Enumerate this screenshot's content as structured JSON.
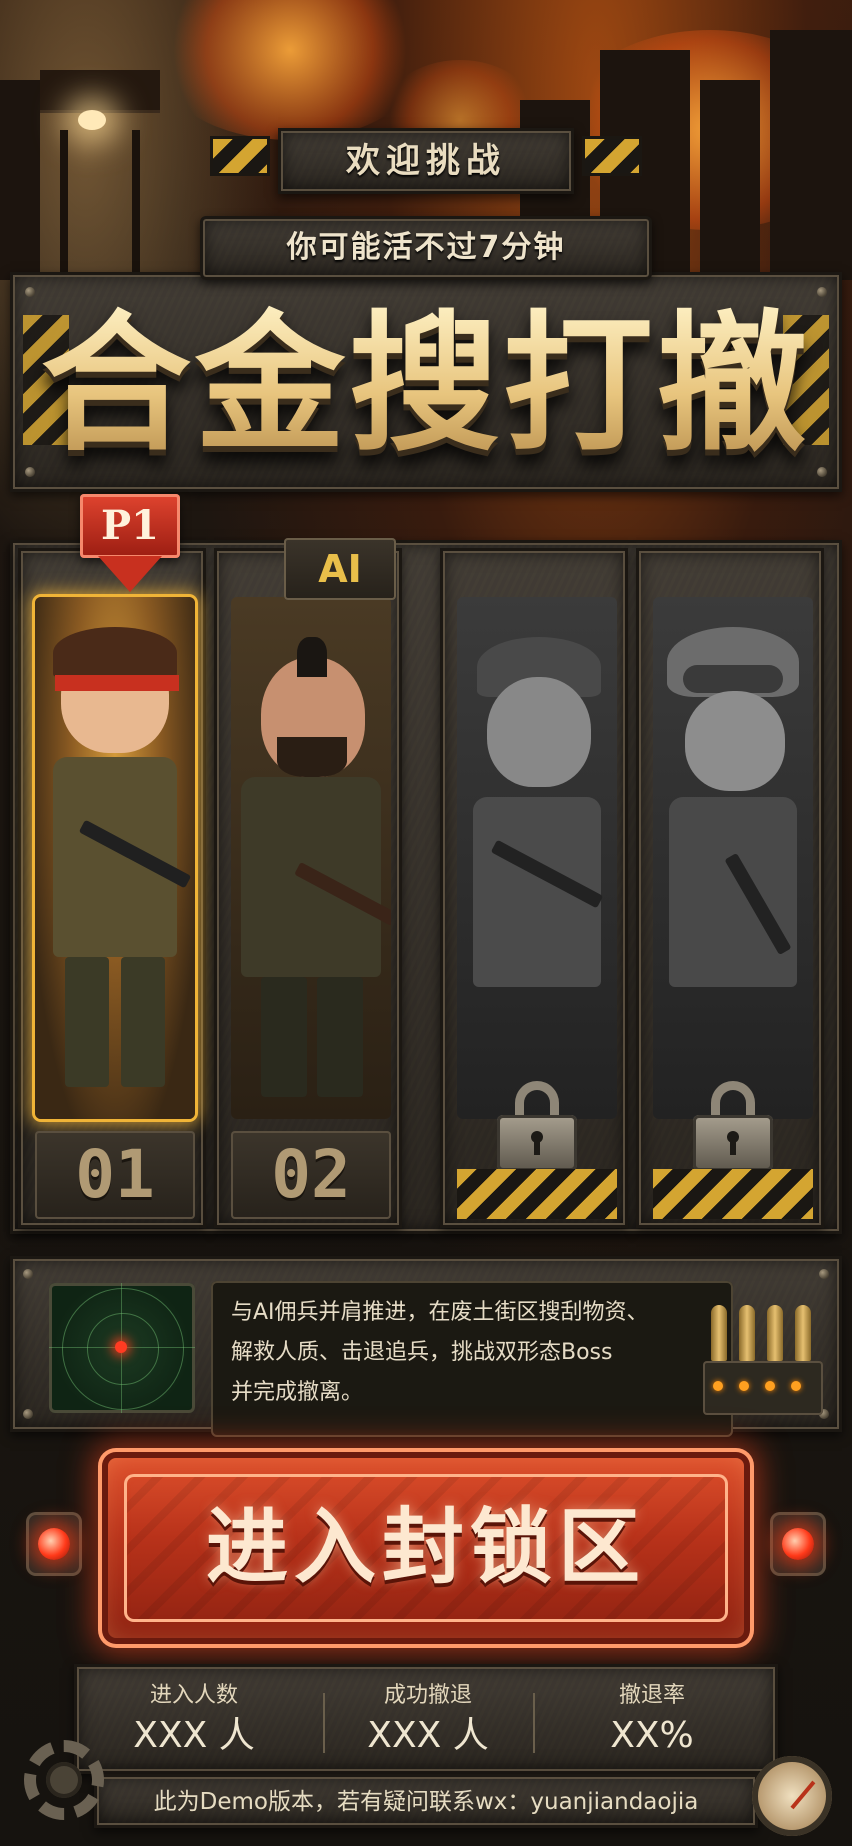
{
  "header": {
    "welcome": "欢迎挑战",
    "subtitle": "你可能活不过7分钟",
    "title": "合金搜打撤"
  },
  "roster": {
    "p1_tag": "P1",
    "ai_tag": "AI",
    "slots": [
      {
        "number": "01",
        "state": "selected",
        "character": "red-headband-soldier"
      },
      {
        "number": "02",
        "state": "ai",
        "character": "mohawk-heavy-gunner"
      },
      {
        "number": "",
        "state": "locked",
        "character": "skull-cap-sniper"
      },
      {
        "number": "",
        "state": "locked",
        "character": "goggles-scout"
      }
    ]
  },
  "briefing": {
    "lines": [
      "与AI佣兵并肩推进，在废土街区搜刮物资、",
      "解救人质、击退追兵，挑战双形态Boss",
      "并完成撤离。"
    ]
  },
  "start_button": {
    "label": "进入封锁区"
  },
  "stats": [
    {
      "label": "进入人数",
      "value": "XXX 人"
    },
    {
      "label": "成功撤退",
      "value": "XXX 人"
    },
    {
      "label": "撤退率",
      "value": "XX%"
    }
  ],
  "footer": {
    "text": "此为Demo版本，若有疑问联系wx：yuanjiandaojia"
  },
  "colors": {
    "accent_gold": "#d4a531",
    "start_red": "#b8321a",
    "p1_red": "#c8301f",
    "ai_yellow": "#e9bf4a"
  }
}
